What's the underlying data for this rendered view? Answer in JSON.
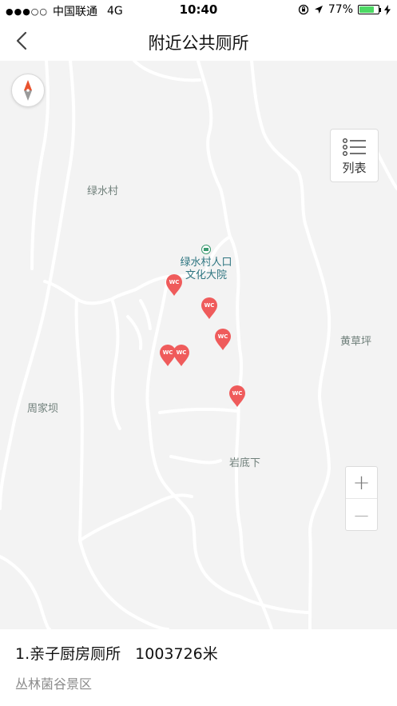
{
  "status_bar": {
    "signal": "●●●○○",
    "carrier": "中国联通",
    "network": "4G",
    "time": "10:40",
    "battery_percent": "77%",
    "battery_level": 0.77,
    "battery_color": "#4cd964"
  },
  "nav": {
    "title": "附近公共厕所"
  },
  "map": {
    "place_labels": {
      "lvshuicun": "绿水村",
      "huangcaoping": "黄草坪",
      "zhoujiaba": "周家坝",
      "yandixia": "岩底下"
    },
    "poi": {
      "line1": "绿水村人口",
      "line2": "文化大院"
    },
    "marker_text": "WC",
    "marker_color": "#ef5b5b",
    "list_button_label": "列表",
    "zoom_in_label": "+",
    "zoom_out_label": "—"
  },
  "result": {
    "title": "1.亲子厨房厕所",
    "distance": "1003726米",
    "subtitle": "丛林菌谷景区"
  }
}
